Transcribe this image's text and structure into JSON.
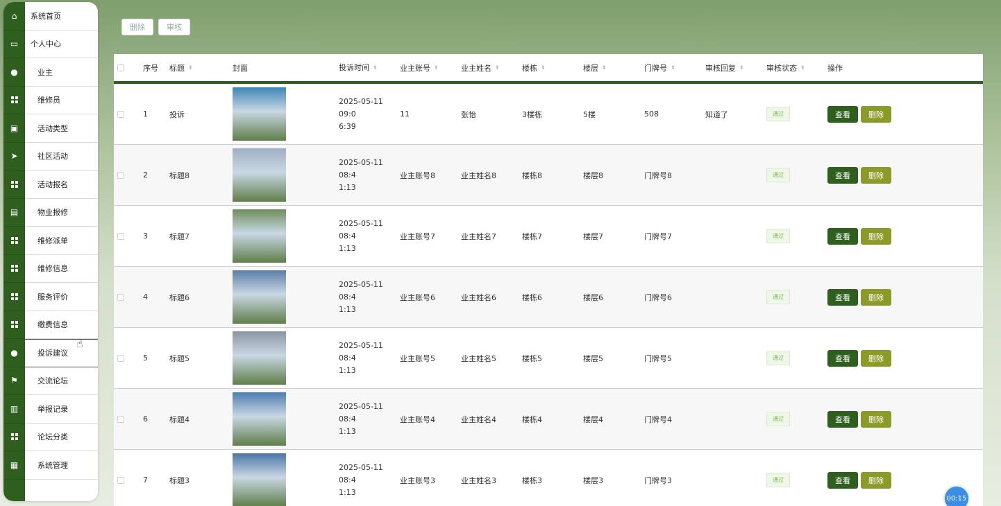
{
  "sidebar": {
    "items": [
      {
        "label": "系统首页",
        "icon": "home-icon",
        "kind": "top"
      },
      {
        "label": "个人中心",
        "icon": "profile-card-icon",
        "kind": "top"
      },
      {
        "label": "业主",
        "icon": "user-icon",
        "kind": "sub"
      },
      {
        "label": "维修员",
        "icon": "grid-icon",
        "kind": "sub"
      },
      {
        "label": "活动类型",
        "icon": "briefcase-icon",
        "kind": "sub"
      },
      {
        "label": "社区活动",
        "icon": "send-icon",
        "kind": "sub"
      },
      {
        "label": "活动报名",
        "icon": "grid-icon",
        "kind": "sub"
      },
      {
        "label": "物业报修",
        "icon": "clipboard-icon",
        "kind": "sub"
      },
      {
        "label": "维修派单",
        "icon": "grid-icon",
        "kind": "sub"
      },
      {
        "label": "维修信息",
        "icon": "grid-icon",
        "kind": "sub"
      },
      {
        "label": "服务评价",
        "icon": "grid-icon",
        "kind": "sub"
      },
      {
        "label": "缴费信息",
        "icon": "grid-icon",
        "kind": "sub"
      },
      {
        "label": "投诉建议",
        "icon": "user-icon",
        "kind": "sub",
        "active": true
      },
      {
        "label": "交流论坛",
        "icon": "flag-icon",
        "kind": "sub"
      },
      {
        "label": "举报记录",
        "icon": "bar-chart-icon",
        "kind": "sub"
      },
      {
        "label": "论坛分类",
        "icon": "grid-icon",
        "kind": "sub"
      },
      {
        "label": "系统管理",
        "icon": "book-icon",
        "kind": "sub"
      }
    ]
  },
  "toolbar": {
    "delete_label": "删除",
    "audit_label": "审核"
  },
  "table": {
    "headers": {
      "index": "序号",
      "title": "标题",
      "cover": "封面",
      "time": "投诉时间",
      "account": "业主账号",
      "name": "业主姓名",
      "building": "楼栋",
      "floor": "楼层",
      "door": "门牌号",
      "reply": "审核回复",
      "status": "审核状态",
      "ops": "操作"
    },
    "rows": [
      {
        "index": "1",
        "title": "投诉",
        "time_line1": "2025-05-11 09:0",
        "time_line2": "6:39",
        "account": "11",
        "name": "张怡",
        "building": "3楼栋",
        "floor": "5楼",
        "door": "508",
        "reply": "知道了",
        "status": "通过",
        "cover_color": "#3d86b5"
      },
      {
        "index": "2",
        "title": "标题8",
        "time_line1": "2025-05-11 08:4",
        "time_line2": "1:13",
        "account": "业主账号8",
        "name": "业主姓名8",
        "building": "楼栋8",
        "floor": "楼层8",
        "door": "门牌号8",
        "reply": "",
        "status": "通过",
        "cover_color": "#9fb0c4"
      },
      {
        "index": "3",
        "title": "标题7",
        "time_line1": "2025-05-11 08:4",
        "time_line2": "1:13",
        "account": "业主账号7",
        "name": "业主姓名7",
        "building": "楼栋7",
        "floor": "楼层7",
        "door": "门牌号7",
        "reply": "",
        "status": "通过",
        "cover_color": "#6f8f5a"
      },
      {
        "index": "4",
        "title": "标题6",
        "time_line1": "2025-05-11 08:4",
        "time_line2": "1:13",
        "account": "业主账号6",
        "name": "业主姓名6",
        "building": "楼栋6",
        "floor": "楼层6",
        "door": "门牌号6",
        "reply": "",
        "status": "通过",
        "cover_color": "#5b7fa6"
      },
      {
        "index": "5",
        "title": "标题5",
        "time_line1": "2025-05-11 08:4",
        "time_line2": "1:13",
        "account": "业主账号5",
        "name": "业主姓名5",
        "building": "楼栋5",
        "floor": "楼层5",
        "door": "门牌号5",
        "reply": "",
        "status": "通过",
        "cover_color": "#8a96a3"
      },
      {
        "index": "6",
        "title": "标题4",
        "time_line1": "2025-05-11 08:4",
        "time_line2": "1:13",
        "account": "业主账号4",
        "name": "业主姓名4",
        "building": "楼栋4",
        "floor": "楼层4",
        "door": "门牌号4",
        "reply": "",
        "status": "通过",
        "cover_color": "#4d7db0"
      },
      {
        "index": "7",
        "title": "标题3",
        "time_line1": "2025-05-11 08:4",
        "time_line2": "1:13",
        "account": "业主账号3",
        "name": "业主姓名3",
        "building": "楼栋3",
        "floor": "楼层3",
        "door": "门牌号3",
        "reply": "",
        "status": "通过",
        "cover_color": "#4a77a8"
      }
    ],
    "view_label": "查看",
    "delete_label": "删除"
  },
  "timer": "00:15",
  "colors": {
    "accent": "#2f5f1e",
    "delete": "#8c9a2a",
    "status_pass": "#7cb35a"
  }
}
